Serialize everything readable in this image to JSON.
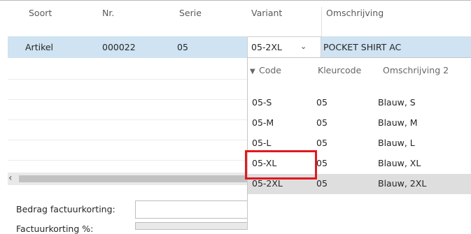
{
  "grid": {
    "columns": [
      "Soort",
      "Nr.",
      "Serie",
      "Variant",
      "Omschrijving"
    ],
    "selected_row": {
      "soort": "Artikel",
      "nr": "000022",
      "serie": "05",
      "variant": "05-2XL",
      "omschrijving": "POCKET SHIRT AC"
    }
  },
  "dropdown": {
    "columns": [
      "Code",
      "Kleurcode",
      "Omschrijving 2"
    ],
    "rows": [
      {
        "code": "05-S",
        "kleurcode": "05",
        "omschrijving2": "Blauw, S"
      },
      {
        "code": "05-M",
        "kleurcode": "05",
        "omschrijving2": "Blauw, M"
      },
      {
        "code": "05-L",
        "kleurcode": "05",
        "omschrijving2": "Blauw, L"
      },
      {
        "code": "05-XL",
        "kleurcode": "05",
        "omschrijving2": "Blauw, XL"
      },
      {
        "code": "05-2XL",
        "kleurcode": "05",
        "omschrijving2": "Blauw, 2XL"
      }
    ],
    "selected_code": "05-2XL"
  },
  "footer": {
    "bedrag_label": "Bedrag factuurkorting:",
    "factuurkorting_label": "Factuurkorting %:"
  },
  "colors": {
    "selected_row": "#cfe3f2",
    "highlight_box": "#e0191f",
    "dropdown_selected": "#dedede"
  }
}
